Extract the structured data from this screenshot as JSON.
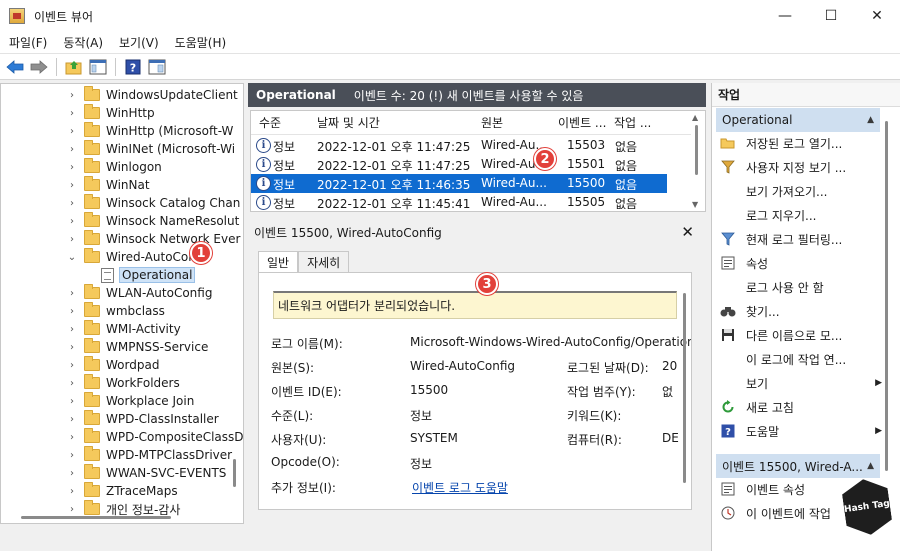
{
  "window": {
    "title": "이벤트 뷰어",
    "minimize": "—",
    "maximize": "☐",
    "close": "✕"
  },
  "menu": [
    "파일(F)",
    "동작(A)",
    "보기(V)",
    "도움말(H)"
  ],
  "tree": {
    "items": [
      {
        "label": "WindowsUpdateClient",
        "expanded": false
      },
      {
        "label": "WinHttp",
        "expanded": false
      },
      {
        "label": "WinHttp (Microsoft-W",
        "expanded": false
      },
      {
        "label": "WinINet (Microsoft-Wi",
        "expanded": false
      },
      {
        "label": "Winlogon",
        "expanded": false
      },
      {
        "label": "WinNat",
        "expanded": false
      },
      {
        "label": "Winsock Catalog Chan",
        "expanded": false
      },
      {
        "label": "Winsock NameResolut",
        "expanded": false
      },
      {
        "label": "Winsock Network Ever",
        "expanded": false
      },
      {
        "label": "Wired-AutoConf",
        "expanded": true
      },
      {
        "label": "Operational",
        "child": true
      },
      {
        "label": "WLAN-AutoConfig",
        "expanded": false
      },
      {
        "label": "wmbclass",
        "expanded": false
      },
      {
        "label": "WMI-Activity",
        "expanded": false
      },
      {
        "label": "WMPNSS-Service",
        "expanded": false
      },
      {
        "label": "Wordpad",
        "expanded": false
      },
      {
        "label": "WorkFolders",
        "expanded": false
      },
      {
        "label": "Workplace Join",
        "expanded": false
      },
      {
        "label": "WPD-ClassInstaller",
        "expanded": false
      },
      {
        "label": "WPD-CompositeClassD",
        "expanded": false
      },
      {
        "label": "WPD-MTPClassDriver",
        "expanded": false
      },
      {
        "label": "WWAN-SVC-EVENTS",
        "expanded": false
      },
      {
        "label": "ZTraceMaps",
        "expanded": false
      },
      {
        "label": "개인 정보-감사",
        "expanded": false
      }
    ]
  },
  "callouts": [
    "1",
    "2",
    "3"
  ],
  "center": {
    "title": "Operational",
    "count": "이벤트 수: 20 (!) 새 이벤트를 사용할 수 있음"
  },
  "events": {
    "columns": [
      "수준",
      "날짜 및 시간",
      "원본",
      "이벤트 ...",
      "작업 ..."
    ],
    "rows": [
      {
        "level": "정보",
        "datetime": "2022-12-01 오후 11:47:25",
        "source": "Wired-Au...",
        "id": "15503",
        "task": "없음",
        "selected": false
      },
      {
        "level": "정보",
        "datetime": "2022-12-01 오후 11:47:25",
        "source": "Wired-Au...",
        "id": "15501",
        "task": "없음",
        "selected": false
      },
      {
        "level": "정보",
        "datetime": "2022-12-01 오후 11:46:35",
        "source": "Wired-Au...",
        "id": "15500",
        "task": "없음",
        "selected": true
      },
      {
        "level": "정보",
        "datetime": "2022-12-01 오후 11:45:41",
        "source": "Wired-Au...",
        "id": "15505",
        "task": "없음",
        "selected": false
      }
    ]
  },
  "detail": {
    "title": "이벤트 15500, Wired-AutoConfig",
    "tabs": [
      "일반",
      "자세히"
    ],
    "message": "네트워크 어댑터가 분리되었습니다.",
    "fields": {
      "log_name_label": "로그 이름(M):",
      "log_name_value": "Microsoft-Windows-Wired-AutoConfig/Operation",
      "source_label": "원본(S):",
      "source_value": "Wired-AutoConfig",
      "logged_label": "로그된 날짜(D):",
      "logged_value": "20",
      "event_id_label": "이벤트 ID(E):",
      "event_id_value": "15500",
      "category_label": "작업 범주(Y):",
      "category_value": "없",
      "level_label": "수준(L):",
      "level_value": "정보",
      "keyword_label": "키워드(K):",
      "keyword_value": "",
      "user_label": "사용자(U):",
      "user_value": "SYSTEM",
      "computer_label": "컴퓨터(R):",
      "computer_value": "DE",
      "opcode_label": "Opcode(O):",
      "opcode_value": "정보",
      "more_label": "추가 정보(I):",
      "more_link": "이벤트 로그 도움말"
    }
  },
  "actions": {
    "title": "작업",
    "section1": "Operational",
    "items1": [
      {
        "label": "저장된 로그 열기...",
        "icon": "folder-open-icon"
      },
      {
        "label": "사용자 지정 보기 ...",
        "icon": "filter-icon"
      },
      {
        "label": "보기 가져오기...",
        "icon": ""
      },
      {
        "label": "로그 지우기...",
        "icon": ""
      },
      {
        "label": "현재 로그 필터링...",
        "icon": "filter-icon"
      },
      {
        "label": "속성",
        "icon": "properties-icon"
      },
      {
        "label": "로그 사용 안 함",
        "icon": ""
      },
      {
        "label": "찾기...",
        "icon": "binoculars-icon"
      },
      {
        "label": "다른 이름으로 모...",
        "icon": "save-icon"
      },
      {
        "label": "이 로그에 작업 연...",
        "icon": ""
      },
      {
        "label": "보기",
        "icon": "",
        "submenu": true
      },
      {
        "label": "새로 고침",
        "icon": "refresh-icon"
      },
      {
        "label": "도움말",
        "icon": "help-icon",
        "submenu": true
      }
    ],
    "section2": "이벤트 15500, Wired-A...",
    "items2": [
      {
        "label": "이벤트 속성",
        "icon": "properties-icon"
      },
      {
        "label": "이 이벤트에 작업",
        "icon": "task-icon"
      }
    ]
  },
  "watermark": "Hash Tag"
}
